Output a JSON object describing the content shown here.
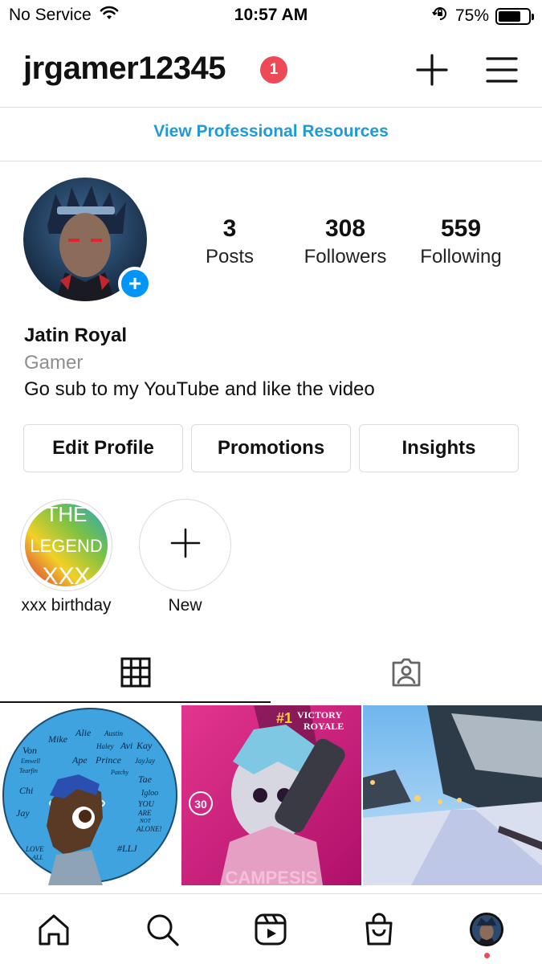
{
  "status_bar": {
    "carrier": "No Service",
    "time": "10:57 AM",
    "battery_percent": "75%",
    "battery_level": 0.75,
    "icons": [
      "wifi-icon",
      "orientation-lock-icon",
      "battery-icon"
    ]
  },
  "header": {
    "username": "jrgamer12345",
    "notification_count": "1",
    "icons": [
      "plus-icon",
      "menu-icon"
    ],
    "badge_color": "#ed4956"
  },
  "pro_link": "View Professional Resources",
  "profile": {
    "stats": [
      {
        "value": "3",
        "label": "Posts"
      },
      {
        "value": "308",
        "label": "Followers"
      },
      {
        "value": "559",
        "label": "Following"
      }
    ],
    "display_name": "Jatin Royal",
    "category": "Gamer",
    "bio": "Go sub to my YouTube and like the video",
    "add_story_symbol": "+"
  },
  "buttons": {
    "edit_profile": "Edit Profile",
    "promotions": "Promotions",
    "insights": "Insights"
  },
  "highlights": [
    {
      "label": "xxx birthday",
      "cover_text": [
        "THE",
        "LEGEND",
        "XXX"
      ]
    },
    {
      "label": "New"
    }
  ],
  "tabs": [
    "grid-icon",
    "tagged-icon"
  ],
  "posts": [
    {
      "kind": "illustration",
      "names": [
        "Alie",
        "Austin",
        "Mike",
        "Haley",
        "Avi",
        "Kay",
        "Von",
        "Emwell",
        "Ape",
        "Prince",
        "JayJay",
        "Tearfin",
        "Patchy",
        "Tae",
        "Chi",
        "Igloo",
        "Jay",
        "YOU",
        "ARE",
        "NOT",
        "ALONE!",
        "LOVE",
        "ALL",
        "#LLJ"
      ]
    },
    {
      "kind": "game-art",
      "texts": [
        "#1",
        "VICTORY",
        "ROYALE",
        "30",
        "CAMPESIS"
      ]
    },
    {
      "kind": "photo"
    }
  ],
  "bottom_nav": [
    "home-icon",
    "search-icon",
    "reels-icon",
    "shop-icon",
    "profile-avatar"
  ],
  "colors": {
    "accent_blue": "#1d9bd8",
    "button_blue": "#0095f6",
    "notification_red": "#ed4956",
    "border": "#dbdbdb"
  }
}
